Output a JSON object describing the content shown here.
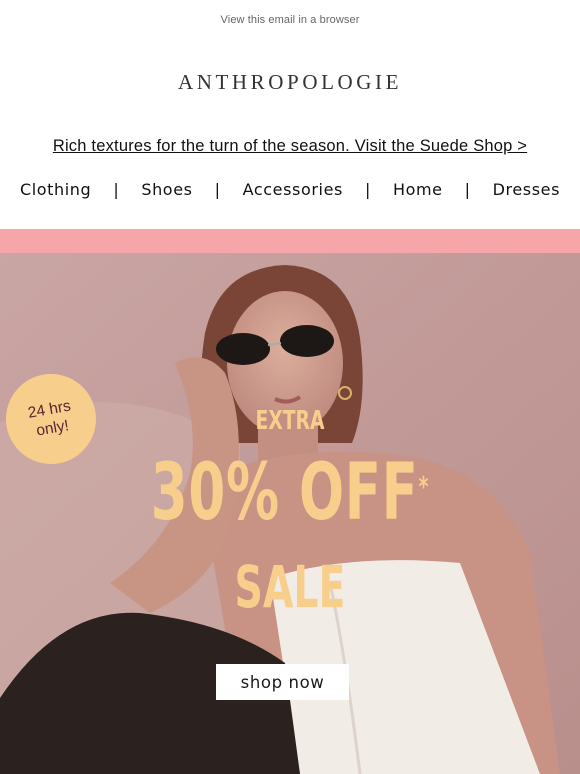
{
  "header": {
    "view_in_browser": "View this email in a browser",
    "logo": "ANTHROPOLOGIE",
    "promo_link": "Rich textures for the turn of the season. Visit the Suede Shop >"
  },
  "nav": {
    "items": [
      "Clothing",
      "Shoes",
      "Accessories",
      "Home",
      "Dresses"
    ],
    "separator": "|"
  },
  "hero": {
    "badge_line1": "24 hrs",
    "badge_line2": "only!",
    "extra": "EXTRA",
    "discount": "30% OFF",
    "asterisk": "*",
    "sale": "SALE",
    "cta": "shop now",
    "colors": {
      "accent": "#f8ce8d",
      "promo_bar": "#f6a6a8",
      "badge_text": "#5a2430"
    }
  }
}
